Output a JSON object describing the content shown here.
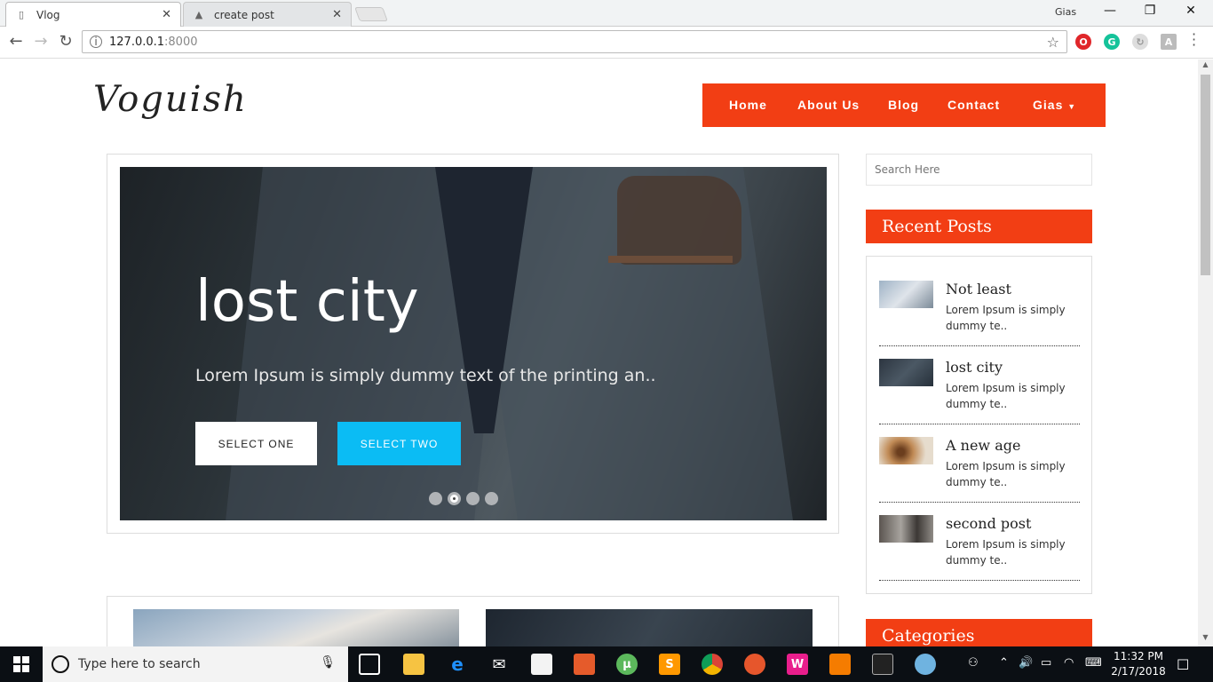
{
  "browser": {
    "tabs": [
      {
        "title": "Vlog",
        "icon": "page-icon"
      },
      {
        "title": "create post",
        "icon": "triangle-icon"
      }
    ],
    "profile_name": "Gias",
    "url_host": "127.0.0.1",
    "url_port": ":8000"
  },
  "site": {
    "logo": "Voguish",
    "nav": [
      "Home",
      "About Us",
      "Blog",
      "Contact",
      "Gias"
    ],
    "slider": {
      "title": "lost city",
      "text": "Lorem Ipsum is simply dummy text of the printing an..",
      "btn_one": "SELECT ONE",
      "btn_two": "SELECT TWO",
      "slide_count": 4,
      "active_slide": 2
    },
    "search_placeholder": "Search Here",
    "recent_posts_title": "Recent Posts",
    "recent_posts": [
      {
        "title": "Not least",
        "excerpt": "Lorem Ipsum is simply dummy te.."
      },
      {
        "title": "lost city",
        "excerpt": "Lorem Ipsum is simply dummy te.."
      },
      {
        "title": "A new age",
        "excerpt": "Lorem Ipsum is simply dummy te.."
      },
      {
        "title": "second post",
        "excerpt": "Lorem Ipsum is simply dummy te.."
      }
    ],
    "categories_title": "Categories",
    "accent_color": "#f23e14",
    "button_blue": "#0bbcf4"
  },
  "taskbar": {
    "search_placeholder": "Type here to search",
    "time": "11:32 PM",
    "date": "2/17/2018"
  }
}
